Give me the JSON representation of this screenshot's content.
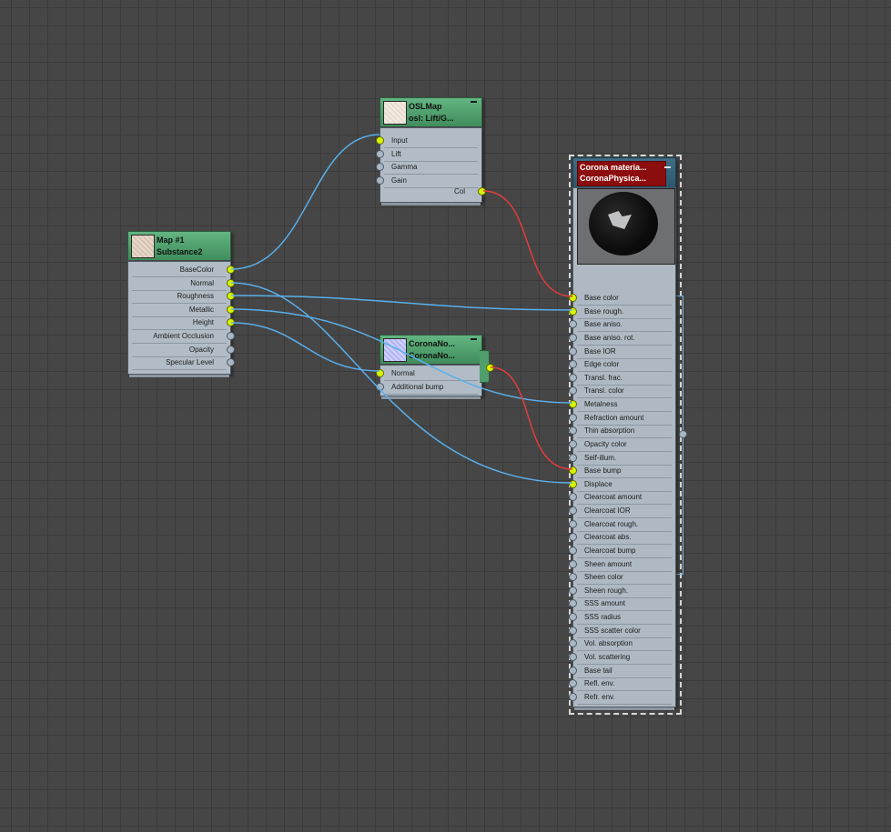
{
  "colors": {
    "canvas_bg": "#464646",
    "wire_blue": "#5aaeea",
    "wire_red": "#e23c3c",
    "socket_active": "#d8f400",
    "socket_idle": "#aab6c2",
    "header_green": "#4f9e6b",
    "header_blue": "#2f5a70",
    "header_red": "#8c0d0d"
  },
  "nodes": {
    "substance": {
      "title_line1": "Map #1",
      "title_line2": "Substance2",
      "thumbnail": "substance-texture-thumbnail",
      "outputs": [
        {
          "label": "BaseColor",
          "connected": true
        },
        {
          "label": "Normal",
          "connected": true
        },
        {
          "label": "Roughness",
          "connected": true
        },
        {
          "label": "Metallic",
          "connected": true
        },
        {
          "label": "Height",
          "connected": true
        },
        {
          "label": "Ambient Occlusion",
          "connected": false
        },
        {
          "label": "Opacity",
          "connected": false
        },
        {
          "label": "Specular Level",
          "connected": false
        }
      ]
    },
    "oslmap": {
      "title_line1": "OSLMap",
      "title_line2": "osl:  Lift/G...",
      "thumbnail": "osl-texture-thumbnail",
      "inputs": [
        {
          "label": "Input",
          "connected": true
        },
        {
          "label": "Lift",
          "connected": false
        },
        {
          "label": "Gamma",
          "connected": false
        },
        {
          "label": "Gain",
          "connected": false
        }
      ],
      "output": {
        "label": "Col",
        "connected": true
      }
    },
    "coronanormal": {
      "title_line1": "CoronaNo...",
      "title_line2": "CoronaNo...",
      "thumbnail": "normal-map-thumbnail",
      "inputs": [
        {
          "label": "Normal",
          "connected": true
        },
        {
          "label": "Additional bump",
          "connected": false
        }
      ],
      "output_connected": true
    },
    "corona_material": {
      "title_line1": "Corona materia...",
      "title_line2": "CoronaPhysica...",
      "preview": "material-preview-sphere",
      "inputs": [
        {
          "label": "Base color",
          "connected": true
        },
        {
          "label": "Base rough.",
          "connected": true
        },
        {
          "label": "Base aniso.",
          "connected": false
        },
        {
          "label": "Base aniso. rot.",
          "connected": false
        },
        {
          "label": "Base IOR",
          "connected": false
        },
        {
          "label": "Edge color",
          "connected": false
        },
        {
          "label": "Transl. frac.",
          "connected": false
        },
        {
          "label": "Transl. color",
          "connected": false
        },
        {
          "label": "Metalness",
          "connected": true
        },
        {
          "label": "Refraction amount",
          "connected": false
        },
        {
          "label": "Thin absorption",
          "connected": false
        },
        {
          "label": "Opacity color",
          "connected": false
        },
        {
          "label": "Self-illum.",
          "connected": false
        },
        {
          "label": "Base bump",
          "connected": true
        },
        {
          "label": "Displace",
          "connected": true
        },
        {
          "label": "Clearcoat amount",
          "connected": false
        },
        {
          "label": "Clearcoat IOR",
          "connected": false
        },
        {
          "label": "Clearcoat rough.",
          "connected": false
        },
        {
          "label": "Clearcoat abs.",
          "connected": false
        },
        {
          "label": "Clearcoat bump",
          "connected": false
        },
        {
          "label": "Sheen amount",
          "connected": false
        },
        {
          "label": "Sheen color",
          "connected": false
        },
        {
          "label": "Sheen rough.",
          "connected": false
        },
        {
          "label": "SSS amount",
          "connected": false
        },
        {
          "label": "SSS radius",
          "connected": false
        },
        {
          "label": "SSS scatter color",
          "connected": false
        },
        {
          "label": "Vol. absorption",
          "connected": false
        },
        {
          "label": "Vol. scattering",
          "connected": false
        },
        {
          "label": "Base tail",
          "connected": false
        },
        {
          "label": "Refl. env.",
          "connected": false
        },
        {
          "label": "Refr. env.",
          "connected": false
        }
      ]
    }
  },
  "connections": [
    {
      "from": "Map #1.BaseColor",
      "to": "OSLMap.Input",
      "color": "blue"
    },
    {
      "from": "OSLMap.Col",
      "to": "Corona material.Base color",
      "color": "red"
    },
    {
      "from": "Map #1.Normal",
      "to": "Corona material.Displace",
      "color": "blue"
    },
    {
      "from": "Map #1.Roughness",
      "to": "Corona material.Base rough.",
      "color": "blue"
    },
    {
      "from": "Map #1.Metallic",
      "to": "Corona material.Metalness",
      "color": "blue"
    },
    {
      "from": "Map #1.Height",
      "to": "CoronaNormal.Normal",
      "color": "blue"
    },
    {
      "from": "CoronaNormal.out",
      "to": "Corona material.Base bump",
      "color": "red"
    }
  ]
}
